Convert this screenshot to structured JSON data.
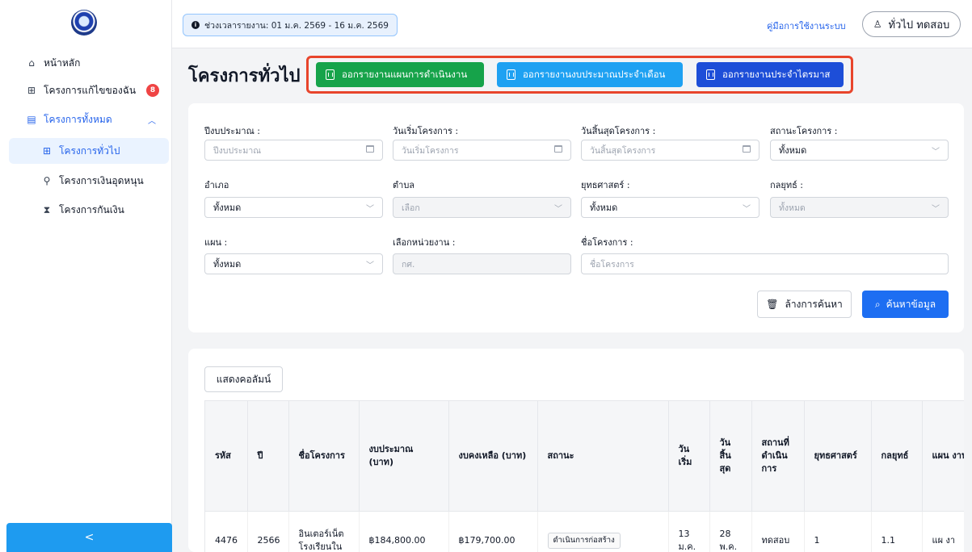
{
  "topbar": {
    "period_text": "ช่วงเวลารายงาน: 01 ม.ค. 2569 - 16 ม.ค. 2569",
    "manual_link": "คู่มือการใช้งานระบบ",
    "user_name": "ทั่วไป ทดสอบ"
  },
  "sidebar": {
    "items": [
      {
        "label": "หน้าหลัก",
        "icon": "home-icon"
      },
      {
        "label": "โครงการแก้ไขของฉัน",
        "icon": "grid-icon",
        "badge": "8"
      },
      {
        "label": "โครงการทั้งหมด",
        "icon": "calendar-icon"
      },
      {
        "label": "โครงการทั่วไป",
        "icon": "grid-icon"
      },
      {
        "label": "โครงการเงินอุดหนุน",
        "icon": "plant-icon"
      },
      {
        "label": "โครงการกันเงิน",
        "icon": "hourglass-icon"
      }
    ],
    "collapse_label": "<"
  },
  "page": {
    "title": "โครงการทั่วไป",
    "export_buttons": [
      {
        "label": "ออกรายงานแผนการดำเนินงาน",
        "color": "#16a34a"
      },
      {
        "label": "ออกรายงานงบประมาณประจำเดือน",
        "color": "#1ea1f2"
      },
      {
        "label": "ออกรายงานประจำไตรมาส",
        "color": "#1d4ed8"
      }
    ]
  },
  "filters": {
    "fiscal_year": {
      "label": "ปีงบประมาณ :",
      "placeholder": "ปีงบประมาณ"
    },
    "start_date": {
      "label": "วันเริ่มโครงการ :",
      "placeholder": "วันเริ่มโครงการ"
    },
    "end_date": {
      "label": "วันสิ้นสุดโครงการ :",
      "placeholder": "วันสิ้นสุดโครงการ"
    },
    "status": {
      "label": "สถานะโครงการ :",
      "value": "ทั้งหมด"
    },
    "district": {
      "label": "อำเภอ",
      "value": "ทั้งหมด"
    },
    "subdistrict": {
      "label": "ตำบล",
      "value": "เลือก"
    },
    "strategy": {
      "label": "ยุทธศาสตร์ :",
      "value": "ทั้งหมด"
    },
    "tactic": {
      "label": "กลยุทธ์ :",
      "value": "ทั้งหมด"
    },
    "plan": {
      "label": "แผน :",
      "value": "ทั้งหมด"
    },
    "unit": {
      "label": "เลือกหน่วยงาน :",
      "value": "กศ."
    },
    "project_name": {
      "label": "ชื่อโครงการ :",
      "placeholder": "ชื่อโครงการ"
    },
    "clear_label": "ล้างการค้นหา",
    "search_label": "ค้นหาข้อมูล"
  },
  "table": {
    "show_columns_label": "แสดงคอลัมน์",
    "headers": [
      "รหัส",
      "ปี",
      "ชื่อโครงการ",
      "งบประมาณ (บาท)",
      "งบคงเหลือ (บาท)",
      "สถานะ",
      "วัน เริ่ม",
      "วัน สิ้น สุด",
      "สถานที่ ดำเนิน การ",
      "ยุทธศาสตร์",
      "กลยุทธ์",
      "แผน งาน"
    ],
    "rows": [
      [
        "4476",
        "2566",
        "อินเตอร์เน็ต โรงเรียนใน",
        "฿184,800.00",
        "฿179,700.00",
        "ดำเนินการก่อสร้าง",
        "13 ม.ค.",
        "28 พ.ค.",
        "ทดสอบ",
        "1",
        "1.1",
        "แผ งา"
      ]
    ]
  }
}
